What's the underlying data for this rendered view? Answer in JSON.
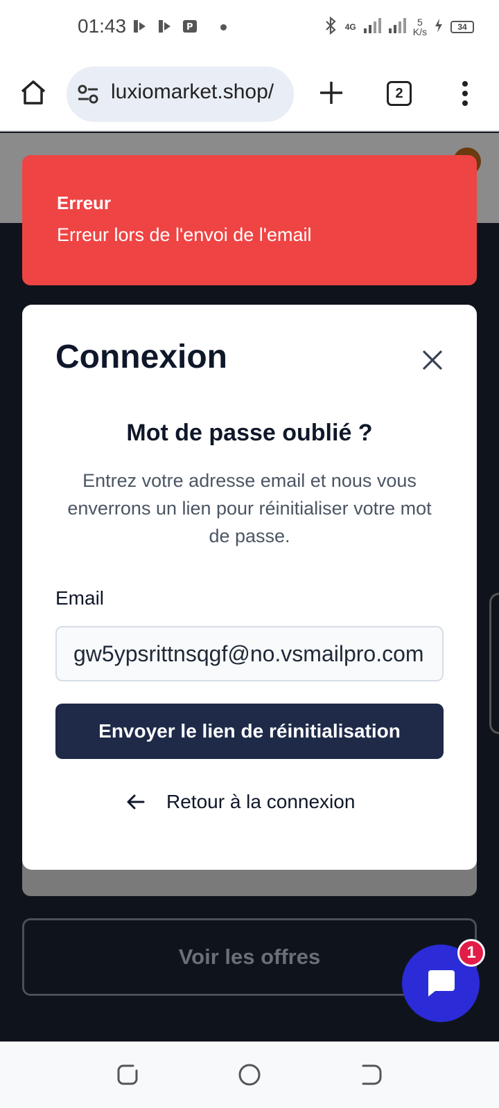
{
  "status_bar": {
    "time": "01:43",
    "network": "4G",
    "speed_value": "5",
    "speed_unit": "K/s",
    "battery": "34"
  },
  "browser": {
    "url": "luxiomarket.shop/",
    "tab_count": "2"
  },
  "toast": {
    "title": "Erreur",
    "message": "Erreur lors de l'envoi de l'email",
    "color": "#ef4444"
  },
  "dialog": {
    "title": "Connexion",
    "subtitle": "Mot de passe oublié ?",
    "description": "Entrez votre adresse email et nous vous enverrons un lien pour réinitialiser votre mot de passe.",
    "email_label": "Email",
    "email_value": "gw5ypsrittnsqgf@no.vsmailpro.com",
    "submit_label": "Envoyer le lien de réinitialisation",
    "back_label": "Retour à la connexion",
    "button_color": "#1e2a48"
  },
  "page": {
    "offers_label": "Voir les offres"
  },
  "chat": {
    "badge_count": "1",
    "color": "#2b2bd8"
  }
}
